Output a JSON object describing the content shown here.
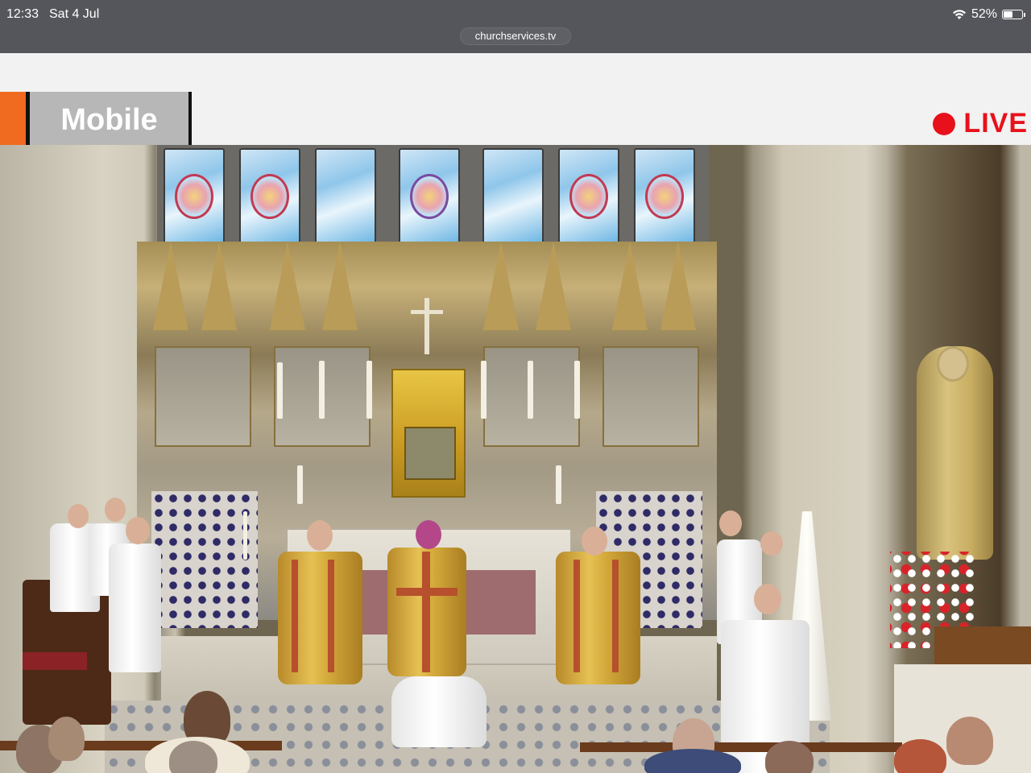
{
  "status_bar": {
    "time": "12:33",
    "date": "Sat 4 Jul",
    "wifi_icon": "wifi-icon",
    "battery_percent": "52%",
    "battery_level": 0.52,
    "battery_icon": "battery-icon"
  },
  "browser": {
    "url": "churchservices.tv"
  },
  "header": {
    "brand_label": "Mobile",
    "accent_color": "#f06a1f",
    "live_label": "LIVE",
    "live_color": "#e8111b"
  },
  "video": {
    "description_icon": "video-frame"
  }
}
